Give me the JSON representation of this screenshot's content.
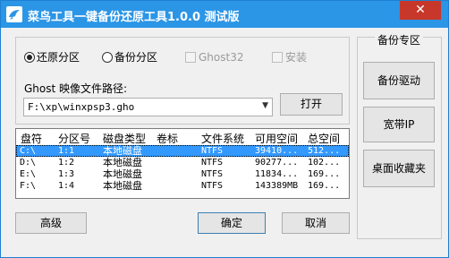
{
  "window": {
    "title": "菜鸟工具一键备份还原工具1.0.0 测试版",
    "close_glyph": "✕",
    "icon": "bird-icon",
    "accent_color": "#2b95e6"
  },
  "mode": {
    "options": [
      {
        "label": "还原分区",
        "checked": true
      },
      {
        "label": "备份分区",
        "checked": false
      }
    ],
    "checkboxes": [
      {
        "label": "Ghost32",
        "checked": false,
        "enabled": false
      },
      {
        "label": "安装",
        "checked": false,
        "enabled": false
      }
    ]
  },
  "ghost_path": {
    "label": "Ghost 映像文件路径:",
    "value": "F:\\xp\\winxpsp3.gho",
    "open_button": "打开"
  },
  "table": {
    "columns": [
      "盘符",
      "分区号",
      "磁盘类型",
      "卷标",
      "文件系统",
      "可用空间",
      "总空间"
    ],
    "rows": [
      [
        "C:\\",
        "1:1",
        "本地磁盘",
        "",
        "NTFS",
        "39410...",
        "512..."
      ],
      [
        "D:\\",
        "1:2",
        "本地磁盘",
        "",
        "NTFS",
        "90277...",
        "102..."
      ],
      [
        "E:\\",
        "1:3",
        "本地磁盘",
        "",
        "NTFS",
        "11834...",
        "169..."
      ],
      [
        "F:\\",
        "1:4",
        "本地磁盘",
        "",
        "NTFS",
        "143389MB",
        "169..."
      ]
    ],
    "selected_row": 0
  },
  "buttons": {
    "advanced": "高级",
    "ok": "确定",
    "cancel": "取消"
  },
  "backup_panel": {
    "title": "备份专区",
    "backup_driver": "备份驱动",
    "broadband_ip": "宽带IP",
    "desktop_favorites": "桌面收藏夹"
  }
}
